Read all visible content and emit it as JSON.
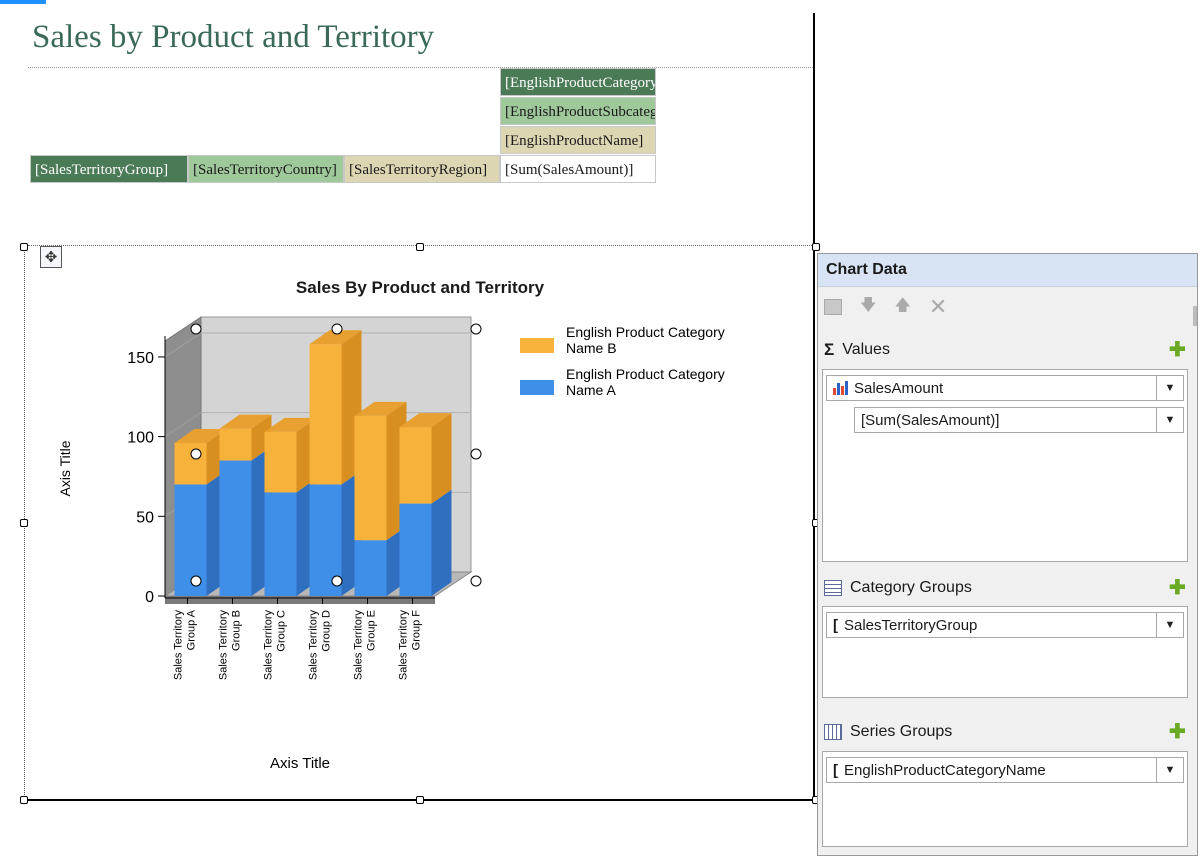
{
  "report": {
    "title": "Sales by Product and Territory",
    "matrix": {
      "col_header_1": "[EnglishProductCategoryName]",
      "col_header_2": "[EnglishProductSubcategoryName]",
      "col_header_3": "[EnglishProductName]",
      "row_header_1": "[SalesTerritoryGroup]",
      "row_header_2": "[SalesTerritoryCountry]",
      "row_header_3": "[SalesTerritoryRegion]",
      "data_cell": "[Sum(SalesAmount)]"
    }
  },
  "chart_data": {
    "type": "bar",
    "stacked": true,
    "three_d": true,
    "title": "Sales By Product and Territory",
    "xlabel": "Axis Title",
    "ylabel": "Axis Title",
    "ylim": [
      0,
      160
    ],
    "yticks": [
      "0",
      "50",
      "100",
      "150"
    ],
    "categories": [
      "Sales Territory Group A",
      "Sales Territory Group B",
      "Sales Territory Group C",
      "Sales Territory Group D",
      "Sales Territory Group E",
      "Sales Territory Group F"
    ],
    "category_lines": [
      [
        "Sales Territory",
        "Group A"
      ],
      [
        "Sales Territory",
        "Group B"
      ],
      [
        "Sales Territory",
        "Group C"
      ],
      [
        "Sales Territory",
        "Group D"
      ],
      [
        "Sales Territory",
        "Group E"
      ],
      [
        "Sales Territory",
        "Group F"
      ]
    ],
    "series": [
      {
        "name": "English Product Category Name A",
        "legend_lines": [
          "English Product Category",
          "Name A"
        ],
        "color": "#3f8ee8",
        "side": "#2f6fc0",
        "top": "#5aa0f0",
        "values": [
          70,
          85,
          65,
          70,
          35,
          58
        ]
      },
      {
        "name": "English Product Category Name B",
        "legend_lines": [
          "English Product Category",
          "Name B"
        ],
        "color": "#f7b23c",
        "side": "#d98f20",
        "top": "#e8a030",
        "values": [
          26,
          20,
          38,
          88,
          78,
          48
        ]
      }
    ],
    "legend_position": "top-right",
    "legend_order": [
      1,
      0
    ]
  },
  "panel": {
    "title": "Chart Data",
    "values_label": "Values",
    "values_field": "SalesAmount",
    "values_expression": "[Sum(SalesAmount)]",
    "category_label": "Category Groups",
    "category_field": "SalesTerritoryGroup",
    "series_label": "Series Groups",
    "series_field": "EnglishProductCategoryName"
  },
  "icons": {
    "values": "sigma-icon",
    "category": "list-icon",
    "series": "table-icon",
    "add": "plus-icon",
    "properties": "properties-icon",
    "move_down": "arrow-down-icon",
    "move_up": "arrow-up-icon",
    "delete": "close-icon"
  }
}
